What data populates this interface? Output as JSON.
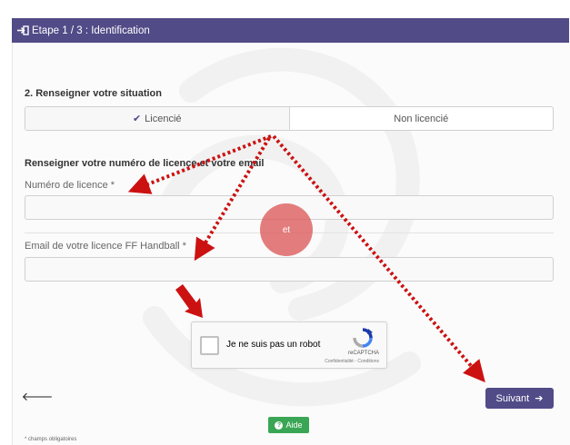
{
  "header": {
    "title": "Etape 1 / 3 : Identification",
    "icon": "sign-in-icon"
  },
  "situation": {
    "title": "2. Renseigner votre situation",
    "options": [
      {
        "label": "Licencié",
        "selected": true,
        "icon": "check-icon"
      },
      {
        "label": "Non licencié",
        "selected": false
      }
    ]
  },
  "licence": {
    "title": "Renseigner votre numéro de licence et votre email",
    "number_label": "Numéro de licence *",
    "number_value": "",
    "email_label": "Email de votre licence FF Handball *",
    "email_value": ""
  },
  "annotation": {
    "circle_text": "et",
    "color": "#cc1111"
  },
  "captcha": {
    "label": "Je ne suis pas un robot",
    "brand": "reCAPTCHA",
    "terms": "Confidentialité - Conditions",
    "checked": false
  },
  "nav": {
    "back_icon": "arrow-left-icon",
    "next_label": "Suivant",
    "next_icon": "arrow-right-icon"
  },
  "help": {
    "label": "Aide",
    "icon": "question-circle-icon"
  },
  "footnote": "* champs obligatoires",
  "colors": {
    "primary": "#514b87",
    "help": "#3aa655",
    "annotation": "#cc1111"
  }
}
